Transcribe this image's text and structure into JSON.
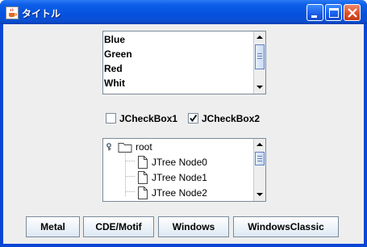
{
  "window": {
    "title": "タイトル",
    "app_icon": "java-cup-icon",
    "controls": [
      "minimize-icon",
      "maximize-icon",
      "close-icon"
    ]
  },
  "list": {
    "items": [
      "Blue",
      "Green",
      "Red",
      "Whit"
    ]
  },
  "checkboxes": [
    {
      "label": "JCheckBox1",
      "checked": false
    },
    {
      "label": "JCheckBox2",
      "checked": true
    }
  ],
  "tree": {
    "root": "root",
    "children": [
      "JTree Node0",
      "JTree Node1",
      "JTree Node2"
    ]
  },
  "buttons": {
    "metal": "Metal",
    "motif": "CDE/Motif",
    "windows": "Windows",
    "windows_classic": "WindowsClassic"
  },
  "colors": {
    "titlebar": "#0551dd",
    "client_bg": "#eeeeee",
    "close_button": "#e0502a"
  }
}
